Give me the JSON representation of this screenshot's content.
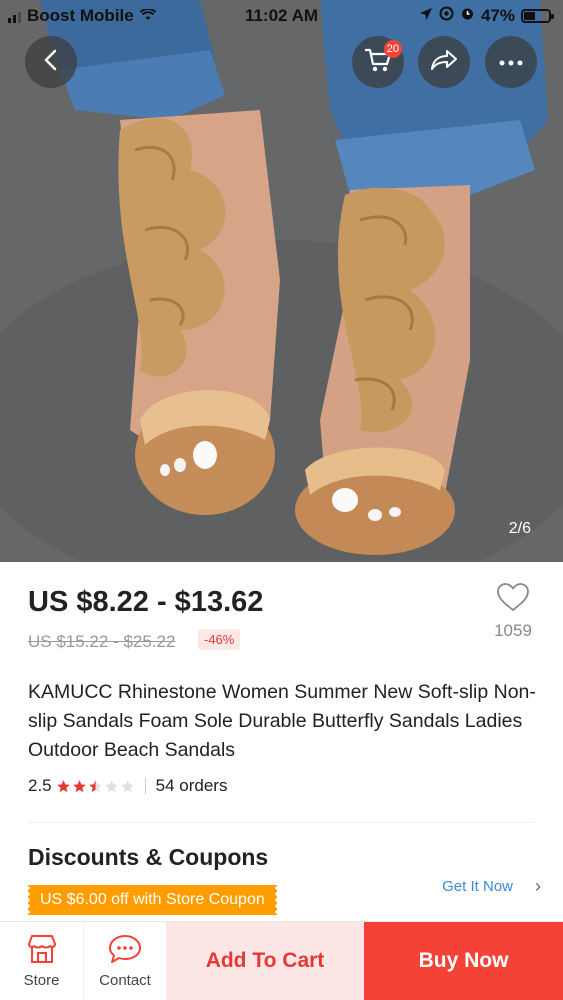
{
  "status_bar": {
    "carrier": "Boost Mobile",
    "time": "11:02 AM",
    "battery": "47%",
    "battery_level": 0.47
  },
  "gallery": {
    "counter": "2/6",
    "cart_badge": "20",
    "icons": [
      "back-arrow-icon",
      "cart-icon",
      "share-icon",
      "more-icon"
    ]
  },
  "product": {
    "price": "US $8.22 - $13.62",
    "original_price": "US $15.22 - $25.22",
    "discount": "-46%",
    "wishlist_count": "1059",
    "title": "KAMUCC Rhinestone Women Summer New Soft-slip Non-slip Sandals Foam Sole Durable Butterfly Sandals Ladies Outdoor Beach Sandals",
    "rating": "2.5",
    "rating_value": 2.5,
    "rating_max": 5,
    "orders": "54 orders"
  },
  "discounts": {
    "heading": "Discounts & Coupons",
    "coupon": "US $6.00 off with Store Coupon",
    "get_it": "Get It Now"
  },
  "bottom_bar": {
    "store": "Store",
    "contact": "Contact",
    "add_to_cart": "Add To Cart",
    "buy_now": "Buy Now"
  },
  "colors": {
    "accent": "#f44336",
    "add_cart_bg": "#fde6e6",
    "coupon": "#ff9d00",
    "link": "#3a8ad6"
  }
}
